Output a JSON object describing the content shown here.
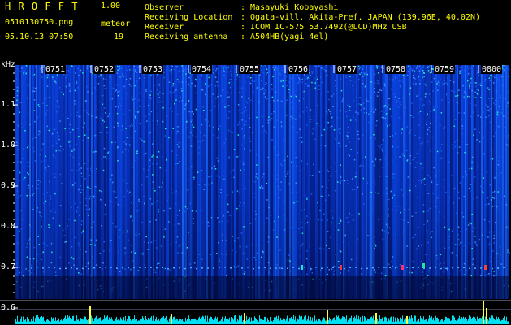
{
  "header": {
    "app_title": "H R O F F T",
    "version": "1.00",
    "filename": "0510130750.png",
    "datetime": "05.10.13 07:50",
    "meteor_label": "meteor",
    "meteor_count": "19",
    "observer_label": "Observer",
    "observer_value": ": Masayuki Kobayashi",
    "location_label": "Receiving Location",
    "location_value": ": Ogata-vill. Akita-Pref. JAPAN (139.96E, 40.02N)",
    "receiver_label": "Receiver",
    "receiver_value": ": ICOM IC-575 53.7492(@LCD)MHz USB",
    "antenna_label": "Receiving antenna",
    "antenna_value": ": A504HB(yagi 4el)"
  },
  "axis": {
    "unit": "kHz",
    "ticks": [
      "1.1",
      "1.0",
      "0.9",
      "0.8",
      "0.7",
      "0.6"
    ]
  },
  "time_labels": [
    "0751",
    "0752",
    "0753",
    "0754",
    "0755",
    "0756",
    "0757",
    "0758",
    "0759",
    "0800"
  ],
  "colors": {
    "background": "#000000",
    "header_text": "#ffff00",
    "axis_text": "#ffffff",
    "spectrum_low": "#00108a",
    "spectrum_mid": "#0050ff",
    "spectrum_high": "#00ffd0"
  }
}
